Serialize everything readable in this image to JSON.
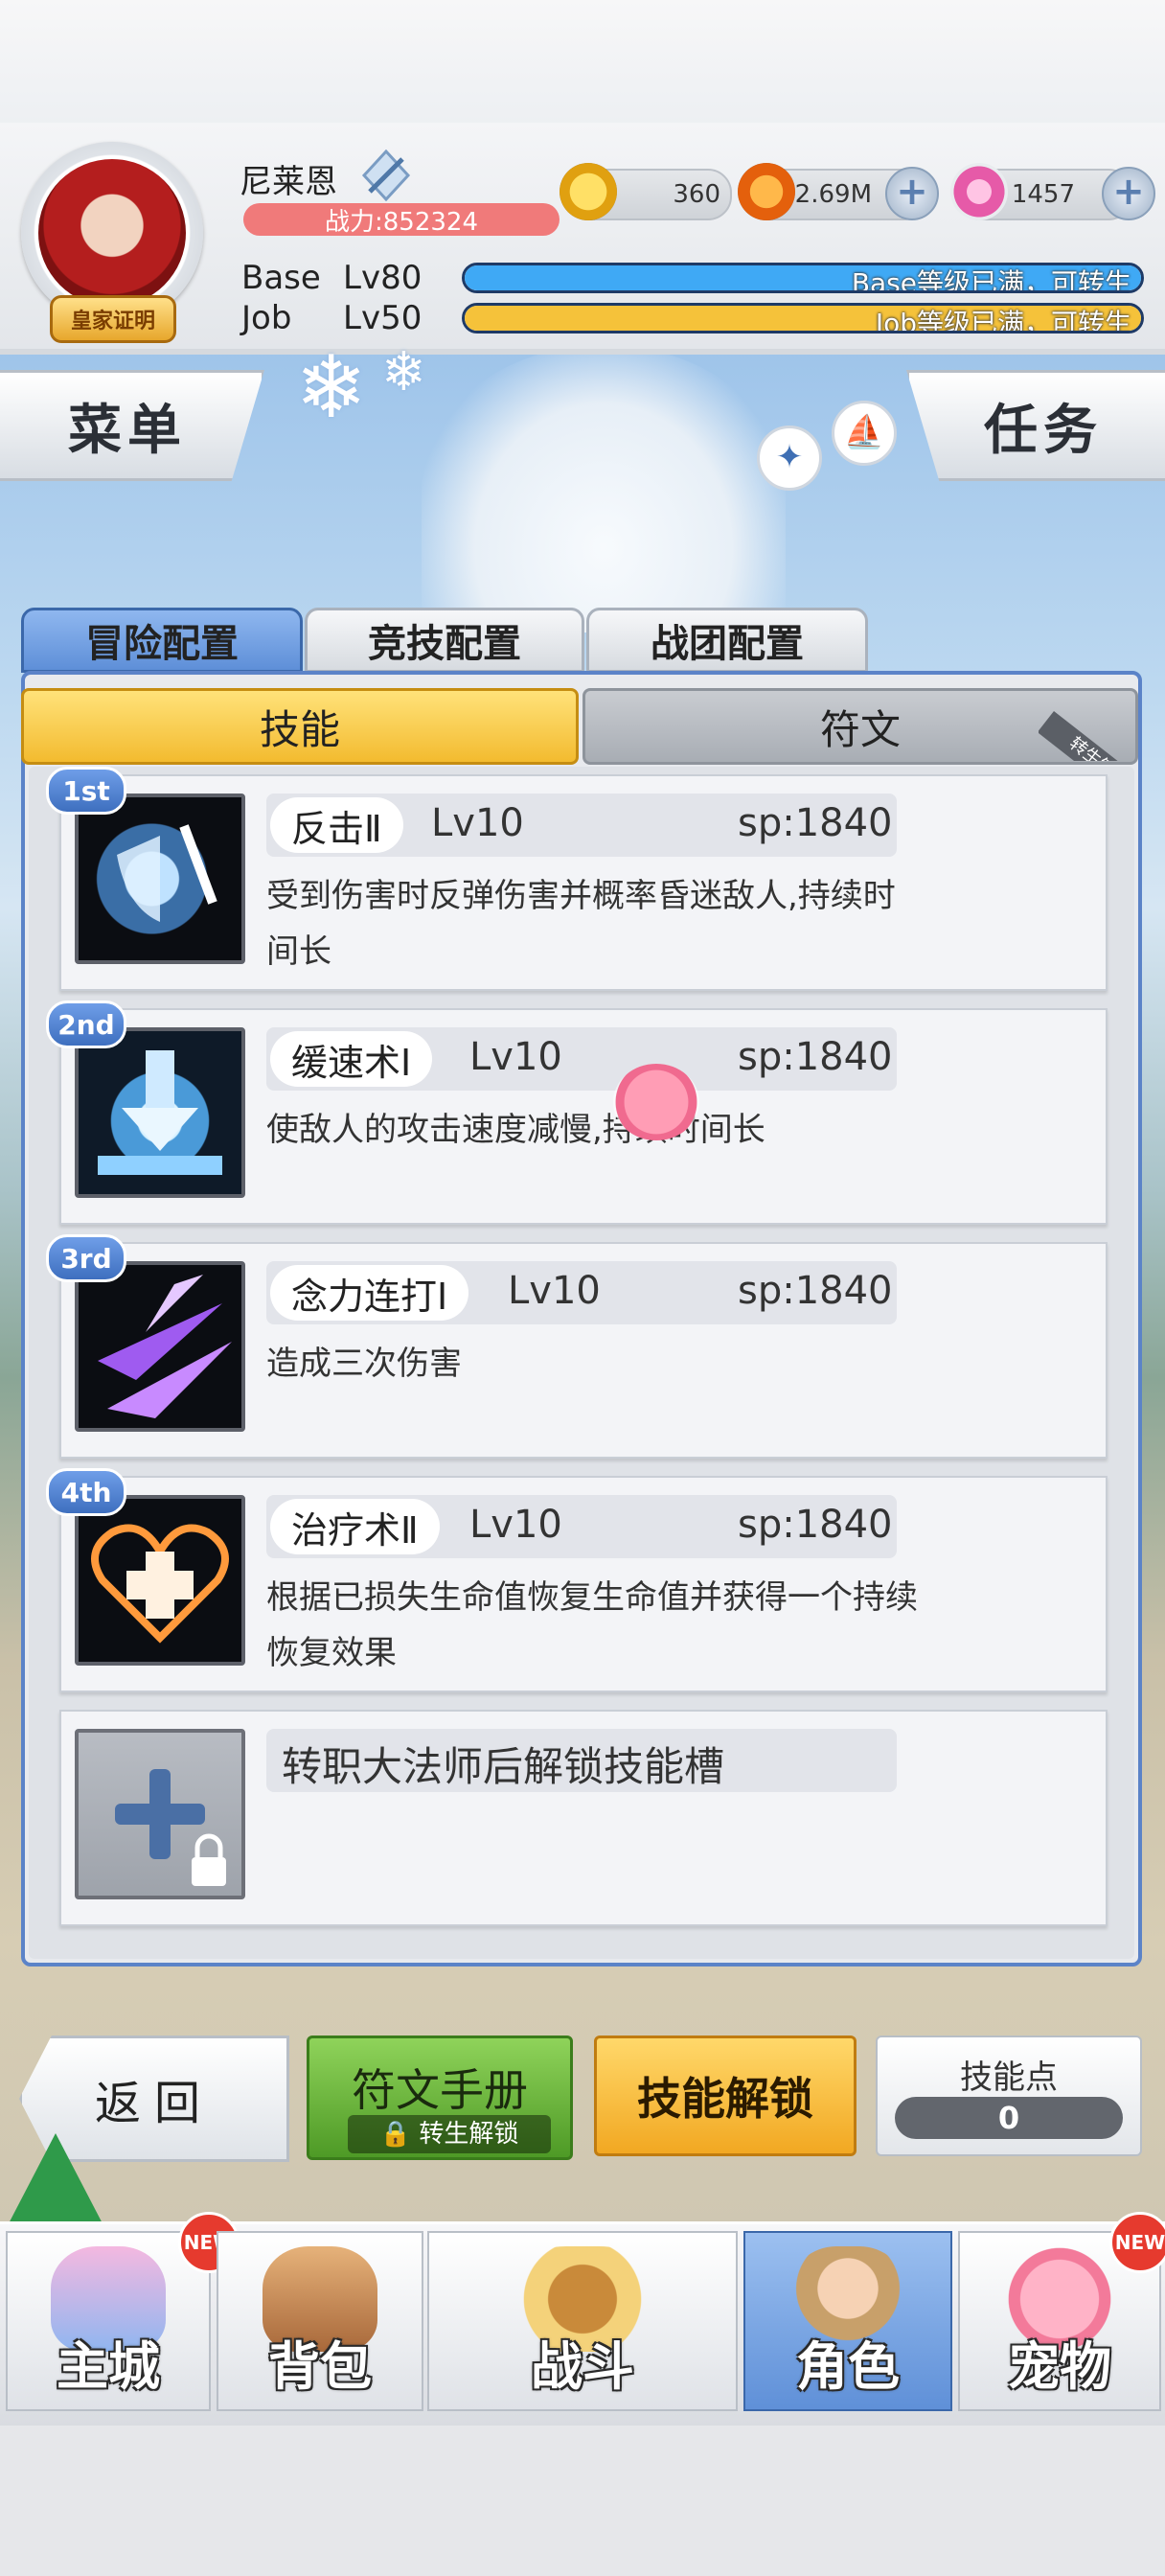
{
  "player": {
    "name": "尼莱恩",
    "badge": "皇家证明",
    "power": "战力:852324"
  },
  "resources": [
    {
      "icon": "zeny-coin-icon",
      "value": "360"
    },
    {
      "icon": "gold-coin-icon",
      "value": "2.69M"
    },
    {
      "icon": "pink-gem-icon",
      "value": "1457"
    }
  ],
  "levels": {
    "base_label": "Base",
    "base_level": "Lv80",
    "base_bar_text": "Base等级已满，可转生",
    "job_label": "Job",
    "job_level": "Lv50",
    "job_bar_text": "Job等级已满，可转生"
  },
  "side_buttons": {
    "menu": "菜单",
    "task": "任务"
  },
  "tabs": [
    "冒险配置",
    "竞技配置",
    "战团配置"
  ],
  "subtabs": {
    "skills": "技能",
    "runes": "符文",
    "runes_ribbon": "转生解锁"
  },
  "skills": [
    {
      "rank": "1st",
      "name": "反击Ⅱ",
      "level": "Lv10",
      "sp": "sp:1840",
      "desc": "受到伤害时反弹伤害并概率昏迷敌人,持续时间长"
    },
    {
      "rank": "2nd",
      "name": "缓速术Ⅰ",
      "level": "Lv10",
      "sp": "sp:1840",
      "desc": "使敌人的攻击速度减慢,持续时间长"
    },
    {
      "rank": "3rd",
      "name": "念力连打Ⅰ",
      "level": "Lv10",
      "sp": "sp:1840",
      "desc": "造成三次伤害"
    },
    {
      "rank": "4th",
      "name": "治疗术Ⅱ",
      "level": "Lv10",
      "sp": "sp:1840",
      "desc": "根据已损失生命值恢复生命值并获得一个持续恢复效果"
    }
  ],
  "locked_slot": {
    "text": "转职大法师后解锁技能槽"
  },
  "actions": {
    "back": "返回",
    "rune_manual": "符文手册",
    "rune_manual_sub": "转生解锁",
    "skill_unlock": "技能解锁",
    "skill_points_label": "技能点",
    "skill_points_value": "0"
  },
  "nav": [
    {
      "label": "主城",
      "new": "NEW"
    },
    {
      "label": "背包"
    },
    {
      "label": "战斗"
    },
    {
      "label": "角色"
    },
    {
      "label": "宠物",
      "new": "NEW"
    }
  ],
  "colors": {
    "base_bar": "#3fa9f5",
    "job_bar": "#f5c23a",
    "tab_active": "#6c9be0",
    "subtab_active": "#f6c94a"
  }
}
